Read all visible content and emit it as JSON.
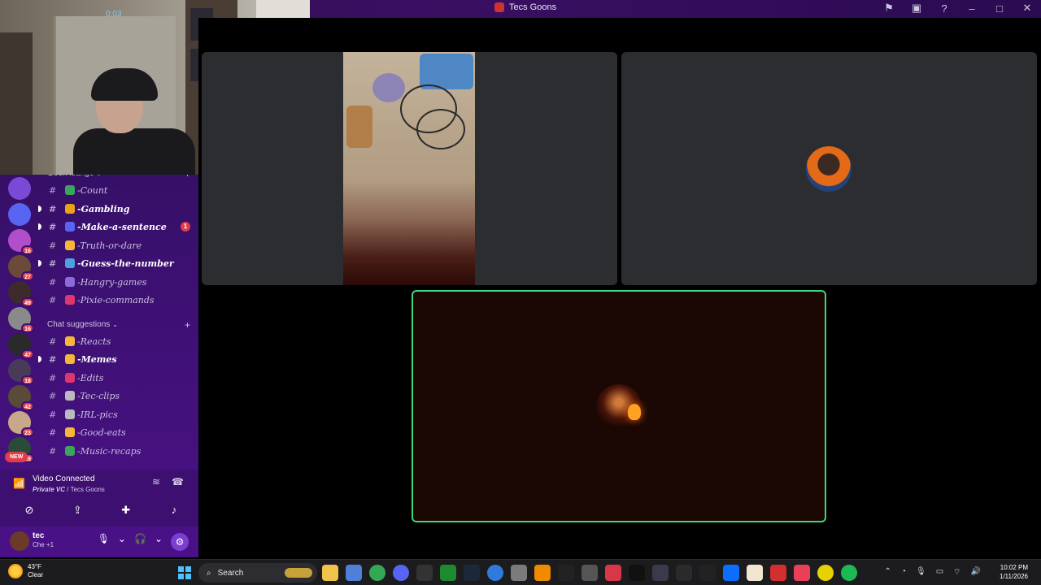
{
  "window": {
    "title": "Tecs Goons"
  },
  "title_icons": [
    "flag-icon",
    "monitor-icon",
    "help-icon",
    "minimize-icon",
    "maximize-icon",
    "close-icon"
  ],
  "sidebar": {
    "categories": [
      {
        "label": "Goon lounge"
      },
      {
        "label": "Chat suggestions"
      }
    ],
    "channels": [
      {
        "name": "-Count",
        "emoji_color": "#3ba55d",
        "bold": false,
        "mention": ""
      },
      {
        "name": "-Gambling",
        "emoji_color": "#e8a317",
        "bold": true,
        "mention": ""
      },
      {
        "name": "-Make-a-sentence",
        "emoji_color": "#5865f2",
        "bold": true,
        "mention": "1"
      },
      {
        "name": "-Truth-or-dare",
        "emoji_color": "#f5b73a",
        "bold": false,
        "mention": ""
      },
      {
        "name": "-Guess-the-number",
        "emoji_color": "#4aa3df",
        "bold": true,
        "mention": ""
      },
      {
        "name": "-Hangry-games",
        "emoji_color": "#8c6bd8",
        "bold": false,
        "mention": ""
      },
      {
        "name": "-Pixie-commands",
        "emoji_color": "#e0356f",
        "bold": false,
        "mention": ""
      },
      {
        "name": "-Reacts",
        "emoji_color": "#f5b73a",
        "bold": false,
        "mention": ""
      },
      {
        "name": "-Memes",
        "emoji_color": "#f5b73a",
        "bold": true,
        "mention": ""
      },
      {
        "name": "-Edits",
        "emoji_color": "#e0356f",
        "bold": false,
        "mention": ""
      },
      {
        "name": "-Tec-clips",
        "emoji_color": "#b9bbbe",
        "bold": false,
        "mention": ""
      },
      {
        "name": "-IRL-pics",
        "emoji_color": "#b9bbbe",
        "bold": false,
        "mention": ""
      },
      {
        "name": "-Good-eats",
        "emoji_color": "#f5b73a",
        "bold": false,
        "mention": ""
      },
      {
        "name": "-Music-recaps",
        "emoji_color": "#3ba55d",
        "bold": false,
        "mention": ""
      }
    ],
    "servers": [
      {
        "badge": ""
      },
      {
        "badge": ""
      },
      {
        "badge": "16"
      },
      {
        "badge": "27"
      },
      {
        "badge": "49"
      },
      {
        "badge": "16"
      },
      {
        "badge": "47"
      },
      {
        "badge": "18"
      },
      {
        "badge": "42"
      },
      {
        "badge": "23"
      },
      {
        "badge": "39"
      }
    ],
    "new_label": "NEW"
  },
  "voice": {
    "status": "Video Connected",
    "channel": "Private VC",
    "server": "Tecs Goons",
    "separator": " / "
  },
  "user": {
    "name": "tec",
    "status": "Che +1"
  },
  "taskbar": {
    "weather_temp": "43°F",
    "weather_desc": "Clear",
    "search_placeholder": "Search",
    "time": "10:02 PM",
    "date": "1/11/2026"
  },
  "webcam": {
    "clock": "0:03"
  }
}
